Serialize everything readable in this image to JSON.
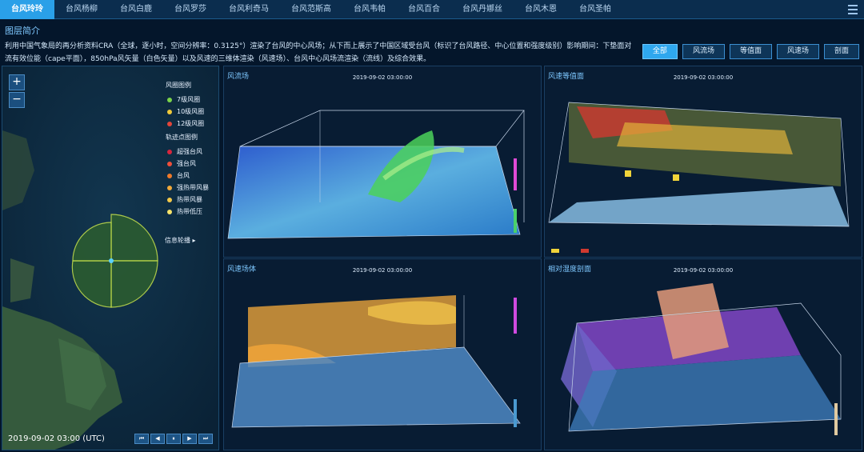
{
  "tabs": [
    {
      "label": "台风玲玲",
      "active": true
    },
    {
      "label": "台风杨柳"
    },
    {
      "label": "台风白鹿"
    },
    {
      "label": "台风罗莎"
    },
    {
      "label": "台风利奇马"
    },
    {
      "label": "台风范斯高"
    },
    {
      "label": "台风韦帕"
    },
    {
      "label": "台风百合"
    },
    {
      "label": "台风丹娜丝"
    },
    {
      "label": "台风木恩"
    },
    {
      "label": "台风圣帕"
    }
  ],
  "intro": {
    "title": "图层简介",
    "text": "利用中国气象局的再分析资料CRA（全球，逐小时，空间分辨率：0.3125°）渲染了台风的中心风场；从下而上展示了中国区域受台风（标识了台风路径、中心位置和强度级别）影响期间：下垫面对流有效位能（cape平面），850hPa风矢量（白色矢量）以及风速的三维体渲染（风速场）、台风中心风场流渲染（流线）及综合效果。"
  },
  "view_buttons": [
    {
      "label": "全部",
      "active": true
    },
    {
      "label": "风流场"
    },
    {
      "label": "等值面"
    },
    {
      "label": "风速场"
    },
    {
      "label": "剖面"
    }
  ],
  "map": {
    "zoom_in": "+",
    "zoom_out": "−",
    "legend_wind_title": "风圈图例",
    "wind_items": [
      {
        "label": "7级风圈",
        "color": "#7bd34a"
      },
      {
        "label": "10级风圈",
        "color": "#f0c93a"
      },
      {
        "label": "12级风圈",
        "color": "#e2453a"
      }
    ],
    "legend_track_title": "轨迹点图例",
    "track_items": [
      {
        "label": "超强台风",
        "color": "#d7263d"
      },
      {
        "label": "强台风",
        "color": "#ef4f3b"
      },
      {
        "label": "台风",
        "color": "#f07a2a"
      },
      {
        "label": "强热带风暴",
        "color": "#f1a93a"
      },
      {
        "label": "热带风暴",
        "color": "#f3c94a"
      },
      {
        "label": "热带低压",
        "color": "#f7e36a"
      }
    ],
    "info_label": "信息轮播 ▸",
    "timestamp": "2019-09-02 03:00 (UTC)",
    "player": [
      "⏮",
      "◀",
      "⏸",
      "▶",
      "⏭"
    ]
  },
  "panels": [
    {
      "title": "风流场",
      "timestamp": "2019-09-02 03:00:00"
    },
    {
      "title": "风速等值面",
      "timestamp": "2019-09-02 03:00:00"
    },
    {
      "title": "风速场体",
      "timestamp": "2019-09-02 03:00:00"
    },
    {
      "title": "相对湿度剖面",
      "timestamp": "2019-09-02 03:00:00"
    }
  ]
}
